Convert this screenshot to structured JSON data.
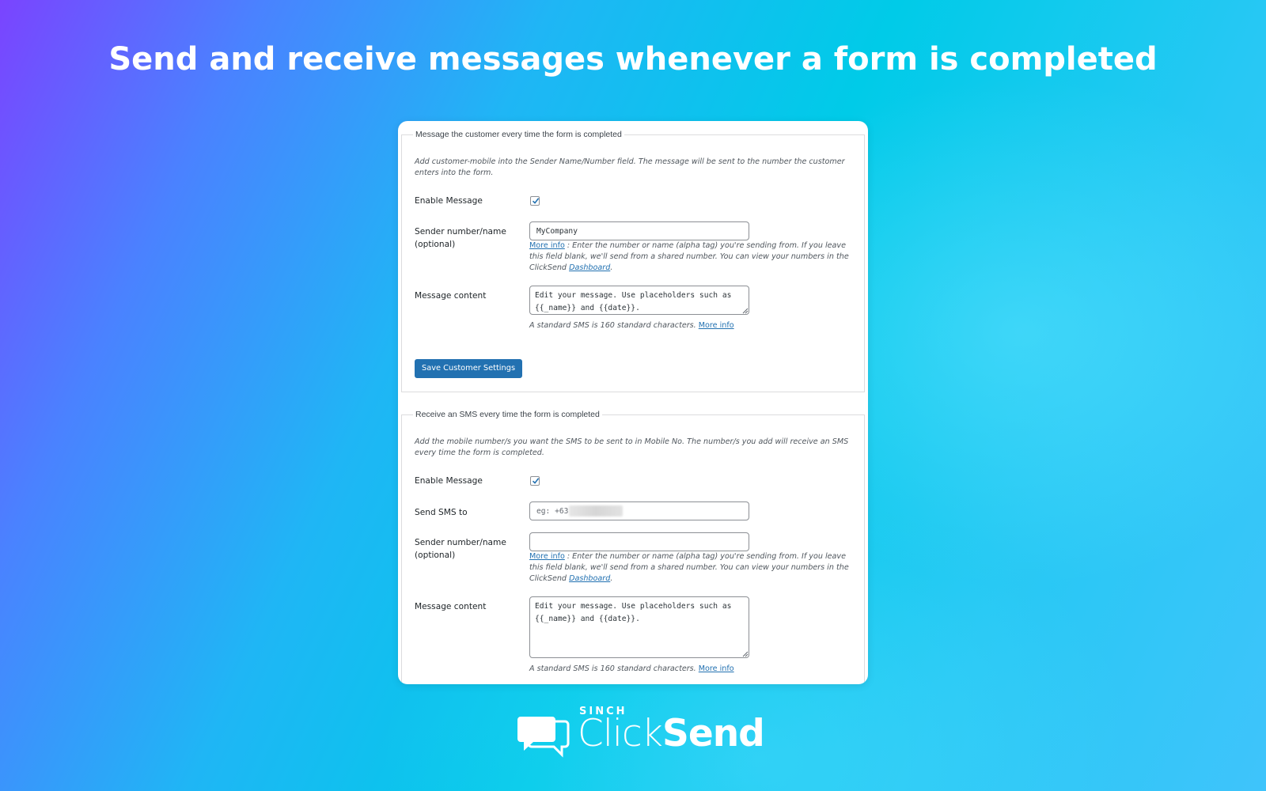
{
  "headline": "Send and receive messages whenever a form is completed",
  "customer": {
    "legend": "Message the customer every time the form is completed",
    "intro": "Add customer-mobile into the Sender Name/Number field. The message will be sent to the number the customer enters into the form.",
    "enable_label": "Enable Message",
    "enable_checked": true,
    "sender_label": "Sender number/name (optional)",
    "sender_value": "MyCompany",
    "sender_help_link": "More info",
    "sender_help_text": " : Enter the number or name (alpha tag) you're sending from. If you leave this field blank, we'll send from a shared number. You can view your numbers in the ClickSend ",
    "sender_help_dashboard": "Dashboard",
    "sender_help_end": ".",
    "message_label": "Message content",
    "message_value": "Edit your message. Use placeholders such as {{_name}} and {{date}}.",
    "sms_note": "A standard SMS is 160 standard characters. ",
    "sms_note_link": "More info",
    "save_button": "Save Customer Settings"
  },
  "receive": {
    "legend": "Receive an SMS every time the form is completed",
    "intro": "Add the mobile number/s you want the SMS to be sent to in Mobile No. The number/s you add will receive an SMS every time the form is completed.",
    "enable_label": "Enable Message",
    "enable_checked": true,
    "sendto_label": "Send SMS to",
    "sendto_placeholder": "eg: +63",
    "sender_label": "Sender number/name (optional)",
    "sender_value": "",
    "sender_help_link": "More info",
    "sender_help_text": " : Enter the number or name (alpha tag) you're sending from. If you leave this field blank, we'll send from a shared number. You can view your numbers in the ClickSend ",
    "sender_help_dashboard": "Dashboard",
    "sender_help_end": ".",
    "message_label": "Message content",
    "message_value": "Edit your message. Use placeholders such as {{_name}} and {{date}}.",
    "sms_note": "A standard SMS is 160 standard characters. ",
    "sms_note_link": "More info"
  },
  "logo": {
    "company": "SINCH",
    "brand_light": "Click",
    "brand_bold": "Send",
    "icon": "chat-bubbles-icon"
  },
  "colors": {
    "accent": "#2271b1",
    "link": "#2271b1",
    "text": "#1d2327"
  }
}
